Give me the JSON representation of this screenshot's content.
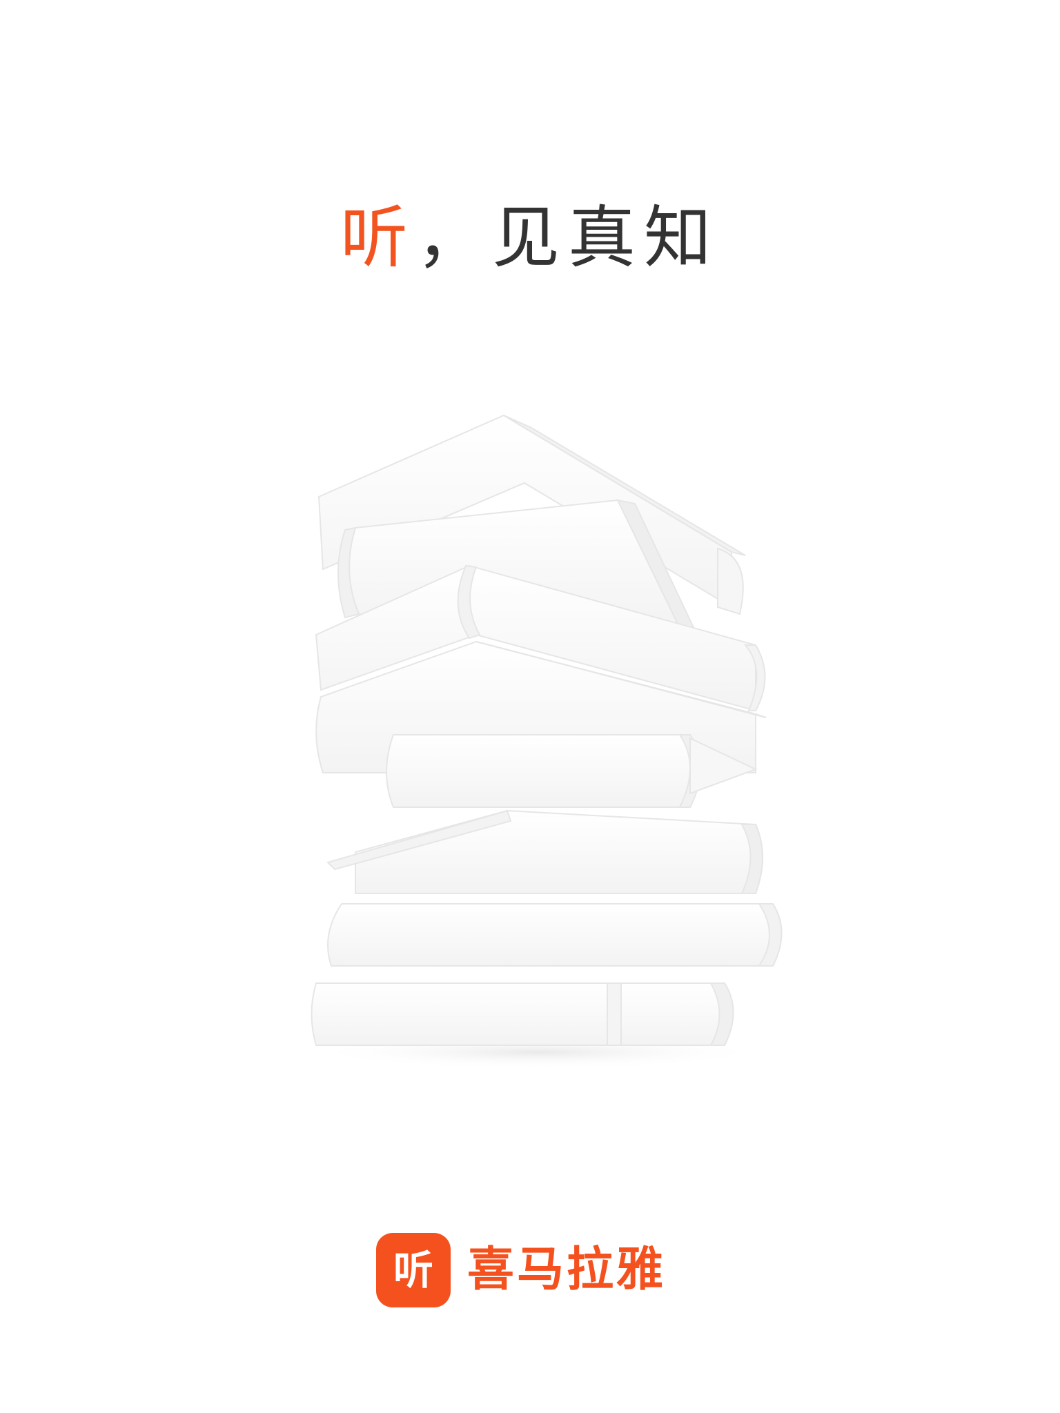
{
  "splash": {
    "slogan_accent": "听",
    "slogan_rest": "，见真知",
    "illustration": "book-stack-icon",
    "brand": {
      "icon_text": "听",
      "name": "喜马拉雅",
      "color": "#f4511e"
    }
  }
}
